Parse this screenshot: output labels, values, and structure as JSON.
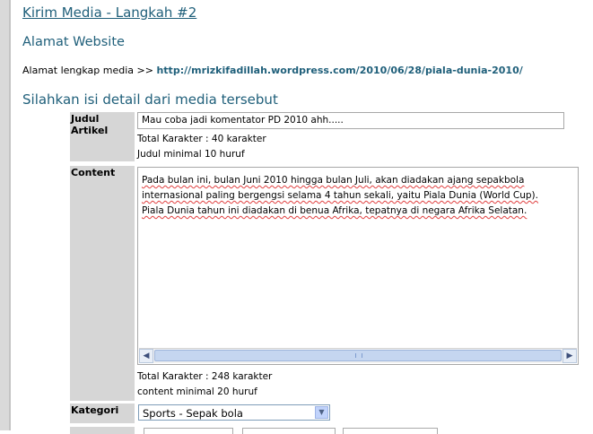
{
  "header": {
    "page_title": "Kirim Media - Langkah #2",
    "website_section": "Alamat Website",
    "url_prefix": "Alamat lengkap media >>",
    "url_value": "http://mrizkifadillah.wordpress.com/2010/06/28/piala-dunia-2010/",
    "detail_section": "Silahkan isi detail dari media tersebut"
  },
  "form": {
    "judul": {
      "label": "Judul Artikel",
      "value": "Mau coba jadi komentator PD 2010 ahh.....",
      "count_text": "Total Karakter : 40 karakter",
      "min_text": "Judul minimal 10 huruf"
    },
    "content": {
      "label": "Content",
      "text": "Pada bulan ini, bulan Juni 2010 hingga bulan Juli, akan diadakan ajang sepakbola internasional paling bergengsi selama 4 tahun sekali, yaitu Piala Dunia (World Cup). Piala Dunia tahun ini diadakan di benua Afrika, tepatnya di negara Afrika Selatan.",
      "count_text": "Total Karakter : 248 karakter",
      "min_text": "content minimal 20 huruf"
    },
    "kategori": {
      "label": "Kategori",
      "selected": "Sports - Sepak bola"
    }
  },
  "icons": {
    "scroll_left": "chevron-left-icon",
    "scroll_right": "chevron-right-icon",
    "dropdown": "chevron-down-icon"
  },
  "colors": {
    "heading": "#1f5f7a",
    "label_bg": "#d6d6d6",
    "spell_underline": "#e04040"
  }
}
